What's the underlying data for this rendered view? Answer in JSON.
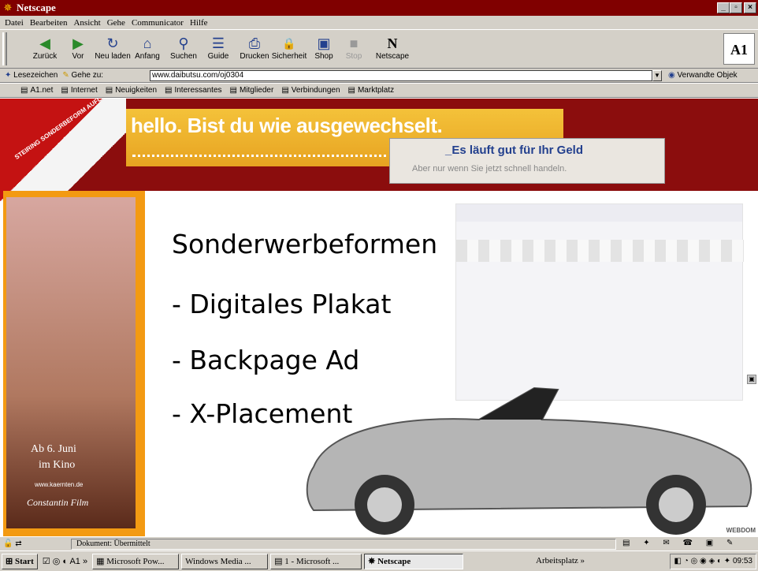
{
  "window": {
    "title": "Netscape",
    "btn_min": "_",
    "btn_max": "▫",
    "btn_close": "×"
  },
  "menubar": [
    "Datei",
    "Bearbeiten",
    "Ansicht",
    "Gehe",
    "Communicator",
    "Hilfe"
  ],
  "toolbar": {
    "buttons": [
      {
        "label": "Zurück",
        "icon": "back-arrow-icon",
        "glyph": "◀"
      },
      {
        "label": "Vor",
        "icon": "forward-arrow-icon",
        "glyph": "▶"
      },
      {
        "label": "Neu laden",
        "icon": "reload-icon",
        "glyph": "↻"
      },
      {
        "label": "Anfang",
        "icon": "home-icon",
        "glyph": "⌂"
      },
      {
        "label": "Suchen",
        "icon": "search-icon",
        "glyph": "⚲"
      },
      {
        "label": "Guide",
        "icon": "guide-icon",
        "glyph": "☰"
      },
      {
        "label": "Drucken",
        "icon": "print-icon",
        "glyph": "⎙"
      },
      {
        "label": "Sicherheit",
        "icon": "lock-icon",
        "glyph": "🔒"
      },
      {
        "label": "Shop",
        "icon": "shop-icon",
        "glyph": "▣"
      },
      {
        "label": "Stop",
        "icon": "stop-icon",
        "glyph": "■"
      },
      {
        "label": "Netscape",
        "icon": "netscape-icon",
        "glyph": "N"
      }
    ],
    "logo": "A1"
  },
  "location": {
    "bookmarks_label": "Lesezeichen",
    "goto_label": "Gehe zu:",
    "url": "www.daibutsu.com/oj0304",
    "related_label": "Verwandte Objek"
  },
  "personal_bar": [
    "A1.net",
    "Internet",
    "Neuigkeiten",
    "Interessantes",
    "Mitglieder",
    "Verbindungen",
    "Marktplatz"
  ],
  "page": {
    "banner_headline": "hello. Bist du wie ausgewechselt.",
    "banner_box_title": "_Es läuft gut für Ihr Geld",
    "banner_box_sub": "Aber nur wenn Sie jetzt schnell handeln.",
    "curl_text": "STEIRING SONDERBEFORM AUFLAGE",
    "poster_line1": "Ab 6. Juni",
    "poster_line2": "im Kino",
    "poster_url": "www.kaernten.de",
    "poster_sig": "Constantin Film",
    "slide_title": "Sonderwerbeformen",
    "slide_items": [
      "- Digitales Plakat",
      "- Backpage Ad",
      "- X-Placement"
    ],
    "corner_logo": "WEBDOM"
  },
  "status": {
    "text": "Dokument: Übermittelt"
  },
  "taskbar": {
    "start": "Start",
    "quick_launch": "A1 »",
    "tasks": [
      "Microsoft Pow...",
      "Windows Media ...",
      "1 - Microsoft ...",
      "Netscape"
    ],
    "tray_label": "Arbeitsplatz »",
    "clock": "09:53"
  }
}
